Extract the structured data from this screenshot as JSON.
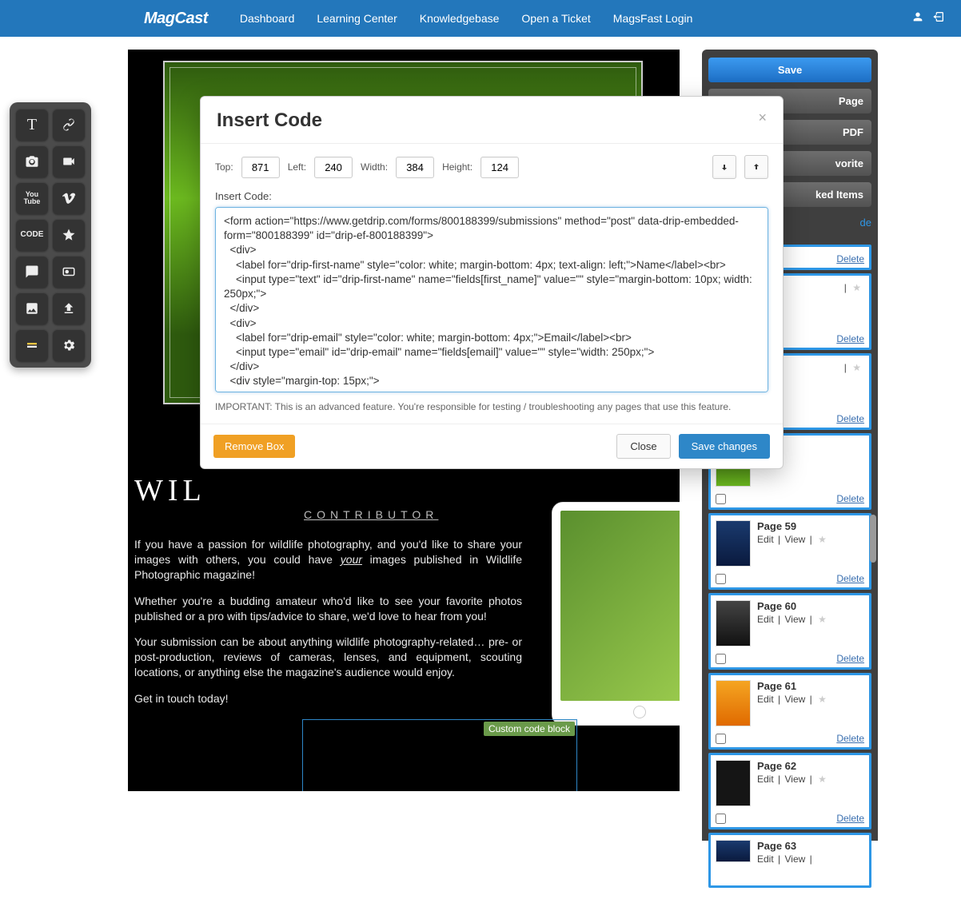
{
  "brand": "MagCast",
  "nav": {
    "dashboard": "Dashboard",
    "learning": "Learning Center",
    "kb": "Knowledgebase",
    "ticket": "Open a Ticket",
    "magsfast": "MagsFast Login"
  },
  "sidebar": {
    "save": "Save",
    "page_partial": "Page",
    "pdf_partial": "PDF",
    "vorite_partial": "vorite",
    "ked_items_partial": "ked Items",
    "de_partial": "de"
  },
  "canvas": {
    "heading_visible": "WIL",
    "subtitle": "CONTRIBUTOR",
    "p1a": "If you have a passion for wildlife photography, and you'd like to share your images with others, you could have ",
    "p1_ital": "your",
    "p1b": " images published in Wildlife Photographic magazine!",
    "p2": "Whether you're a budding amateur who'd like to see your favorite photos published or a pro with tips/advice to share, we'd love to hear from you!",
    "p3": "Your submission can be about anything wildlife photography-related… pre- or post-production, reviews of cameras, lenses, and equipment, scouting locations, or anything else the magazine's audience would enjoy.",
    "p4": "Get in touch today!",
    "custom_badge": "Custom code block"
  },
  "pages": [
    {
      "title": "",
      "thumb": "green",
      "stub": true
    },
    {
      "title": "",
      "thumb": "green",
      "stub": true
    },
    {
      "title": "",
      "thumb": "green",
      "stub": true
    },
    {
      "title": "",
      "thumb": "green"
    },
    {
      "title": "Page 59",
      "thumb": "blue"
    },
    {
      "title": "Page 60",
      "thumb": "moody"
    },
    {
      "title": "Page 61",
      "thumb": "orange"
    },
    {
      "title": "Page 62",
      "thumb": "dark"
    },
    {
      "title": "Page 63",
      "thumb": "blue",
      "partial": true
    }
  ],
  "page_actions": {
    "edit": "Edit",
    "view": "View",
    "sep": "|",
    "delete": "Delete"
  },
  "modal": {
    "title": "Insert Code",
    "labels": {
      "top": "Top:",
      "left": "Left:",
      "width": "Width:",
      "height": "Height:"
    },
    "values": {
      "top": "871",
      "left": "240",
      "width": "384",
      "height": "124"
    },
    "insert_label": "Insert Code:",
    "code": "<form action=\"https://www.getdrip.com/forms/800188399/submissions\" method=\"post\" data-drip-embedded-form=\"800188399\" id=\"drip-ef-800188399\">\n  <div>\n    <label for=\"drip-first-name\" style=\"color: white; margin-bottom: 4px; text-align: left;\">Name</label><br>\n    <input type=\"text\" id=\"drip-first-name\" name=\"fields[first_name]\" value=\"\" style=\"margin-bottom: 10px; width: 250px;\">\n  </div>\n  <div>\n    <label for=\"drip-email\" style=\"color: white; margin-bottom: 4px;\">Email</label><br>\n    <input type=\"email\" id=\"drip-email\" name=\"fields[email]\" value=\"\" style=\"width: 250px;\">\n  </div>\n  <div style=\"margin-top: 15px;\">",
    "note": "IMPORTANT: This is an advanced feature. You're responsible for testing / troubleshooting any pages that use this feature.",
    "remove": "Remove Box",
    "close": "Close",
    "save": "Save changes"
  }
}
